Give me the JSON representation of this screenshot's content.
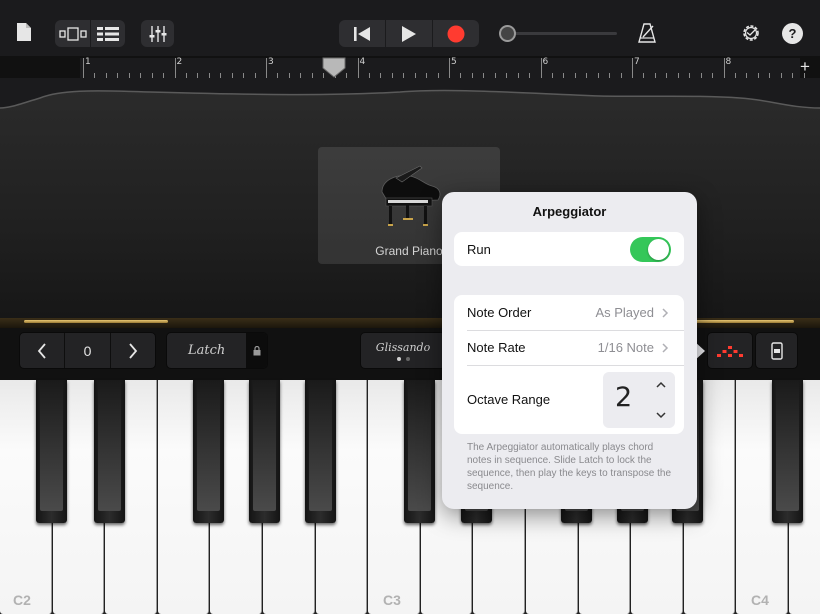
{
  "toolbar": {
    "icons": [
      "document-icon",
      "view-toggle-icon",
      "tracks-view-icon",
      "mixer-icon",
      "rewind-icon",
      "play-icon",
      "record-icon",
      "master-volume-slider",
      "metronome-icon",
      "settings-icon",
      "help-icon"
    ],
    "record_color": "#ff3b30",
    "volume_level": 0
  },
  "ruler": {
    "bars": [
      "1",
      "2",
      "3",
      "4",
      "5",
      "6",
      "7",
      "8"
    ],
    "add_label": "+"
  },
  "instrument": {
    "name": "Grand Piano"
  },
  "controls": {
    "octave_value": "0",
    "latch_label": "Latch",
    "glissando_label": "Glissando"
  },
  "keyboard": {
    "labels": [
      "C2",
      "C3",
      "C4"
    ]
  },
  "arpeggiator": {
    "title": "Arpeggiator",
    "run_label": "Run",
    "run_on": true,
    "note_order_label": "Note Order",
    "note_order_value": "As Played",
    "note_rate_label": "Note Rate",
    "note_rate_value": "1/16 Note",
    "octave_range_label": "Octave Range",
    "octave_range_value": "2",
    "description": "The Arpeggiator automatically plays chord notes in sequence. Slide Latch to lock the sequence, then play the keys to transpose the sequence.",
    "accent": "#34c759"
  }
}
